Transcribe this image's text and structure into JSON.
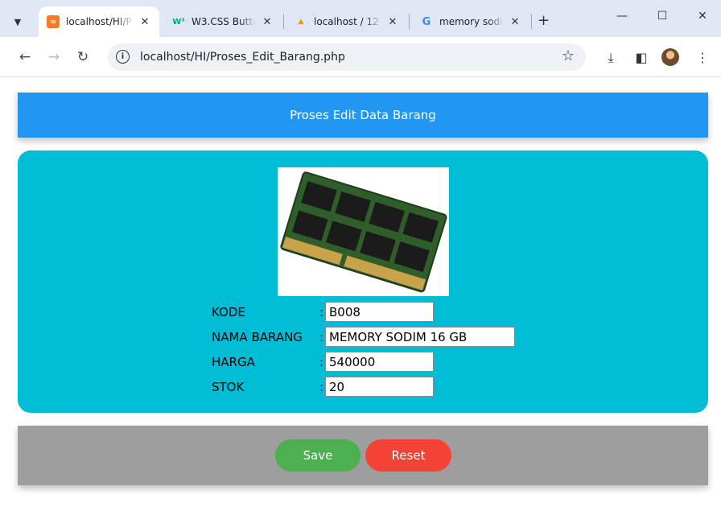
{
  "browser": {
    "tabs": [
      {
        "title": "localhost/HI/P",
        "favicon": "xampp-icon",
        "active": true
      },
      {
        "title": "W3.CSS Butto",
        "favicon": "w3schools-icon",
        "active": false
      },
      {
        "title": "localhost / 12",
        "favicon": "phpmyadmin-icon",
        "active": false
      },
      {
        "title": "memory sodim",
        "favicon": "google-icon",
        "active": false
      }
    ],
    "url": "localhost/HI/Proses_Edit_Barang.php"
  },
  "page": {
    "header_title": "Proses Edit Data Barang",
    "colors": {
      "header": "#2196f3",
      "card": "#00bcd4",
      "footer": "#9e9e9e",
      "save": "#4caf50",
      "reset": "#f44336"
    },
    "fields": [
      {
        "label": "KODE",
        "value": "B008"
      },
      {
        "label": "NAMA BARANG",
        "value": "MEMORY SODIM 16 GB"
      },
      {
        "label": "HARGA",
        "value": "540000"
      },
      {
        "label": "STOK",
        "value": "20"
      }
    ],
    "separator": ":",
    "buttons": {
      "save": "Save",
      "reset": "Reset"
    }
  }
}
